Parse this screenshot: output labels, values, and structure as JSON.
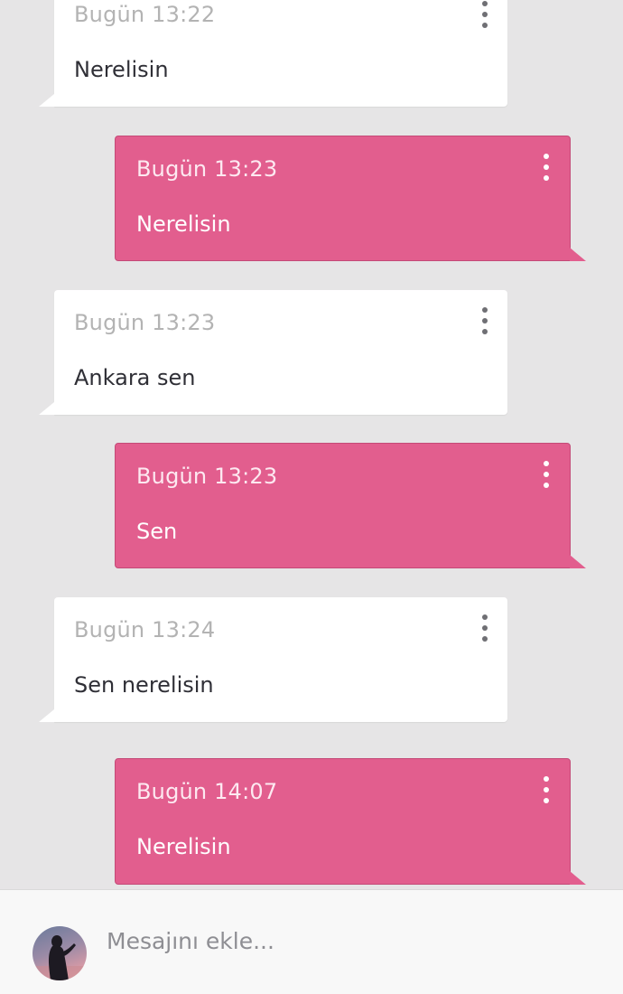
{
  "messages": [
    {
      "direction": "incoming",
      "time": "Bugün 13:22",
      "text": "Nerelisin"
    },
    {
      "direction": "outgoing",
      "time": "Bugün 13:23",
      "text": "Nerelisin"
    },
    {
      "direction": "incoming",
      "time": "Bugün 13:23",
      "text": "Ankara sen"
    },
    {
      "direction": "outgoing",
      "time": "Bugün 13:23",
      "text": "Sen"
    },
    {
      "direction": "incoming",
      "time": "Bugün 13:24",
      "text": "Sen nerelisin"
    },
    {
      "direction": "outgoing",
      "time": "Bugün 14:07",
      "text": "Nerelisin"
    }
  ],
  "composer": {
    "placeholder": "Mesajını ekle...",
    "value": "",
    "avatar_icon": "user-avatar-icon"
  },
  "colors": {
    "incoming_bubble": "#ffffff",
    "outgoing_bubble": "#e25e8e",
    "background": "#e6e5e6"
  }
}
